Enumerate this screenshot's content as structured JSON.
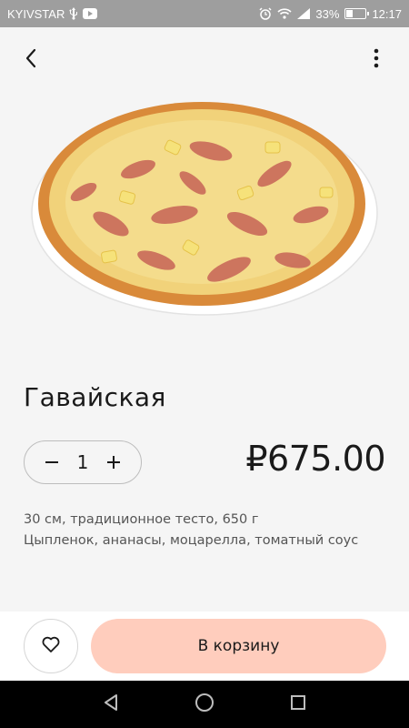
{
  "status_bar": {
    "carrier": "KYIVSTAR",
    "battery_text": "33%",
    "battery_level": 0.33,
    "time": "12:17"
  },
  "product": {
    "title": "Гавайская",
    "quantity": "1",
    "price": "₽675.00",
    "description_line1": "30 см, традиционное тесто, 650 г",
    "description_line2": "Цыпленок, ананасы, моцарелла, томатный соус"
  },
  "actions": {
    "cart_label": "В корзину"
  },
  "icons": {
    "back": "back-arrow-icon",
    "more": "more-vertical-icon",
    "favorite": "heart-icon",
    "nav_back": "triangle-back-icon",
    "nav_home": "circle-home-icon",
    "nav_recent": "square-recent-icon"
  },
  "colors": {
    "cart_button": "#ffcdbd",
    "status_bar": "#9e9e9e",
    "background": "#f5f5f5"
  }
}
